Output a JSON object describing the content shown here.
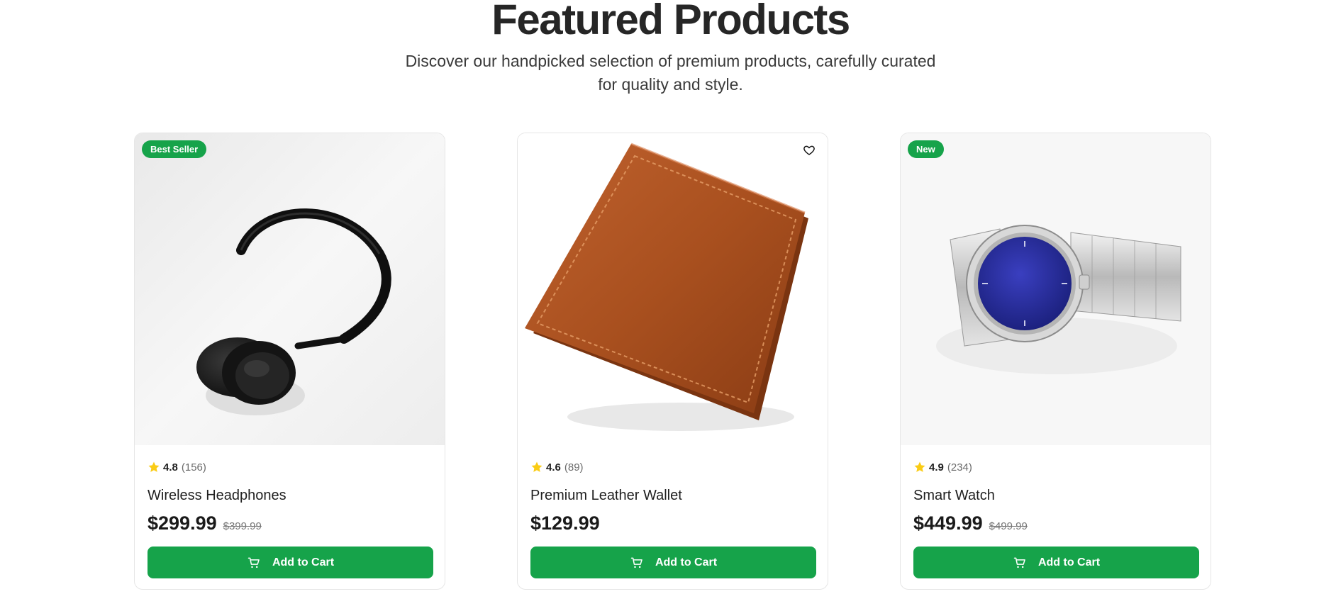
{
  "header": {
    "title": "Featured Products",
    "subtitle": "Discover our handpicked selection of premium products, carefully curated for quality and style."
  },
  "colors": {
    "accent": "#16a34a",
    "star": "#facc15"
  },
  "products": [
    {
      "badge": "Best Seller",
      "image_icon": "headphones-image",
      "rating": "4.8",
      "reviews": "(156)",
      "name": "Wireless Headphones",
      "price": "$299.99",
      "old_price": "$399.99",
      "button_label": "Add to Cart"
    },
    {
      "badge": "",
      "wishlist_icon": "heart-icon",
      "image_icon": "wallet-image",
      "rating": "4.6",
      "reviews": "(89)",
      "name": "Premium Leather Wallet",
      "price": "$129.99",
      "old_price": "",
      "button_label": "Add to Cart"
    },
    {
      "badge": "New",
      "image_icon": "watch-image",
      "rating": "4.9",
      "reviews": "(234)",
      "name": "Smart Watch",
      "price": "$449.99",
      "old_price": "$499.99",
      "button_label": "Add to Cart"
    }
  ]
}
